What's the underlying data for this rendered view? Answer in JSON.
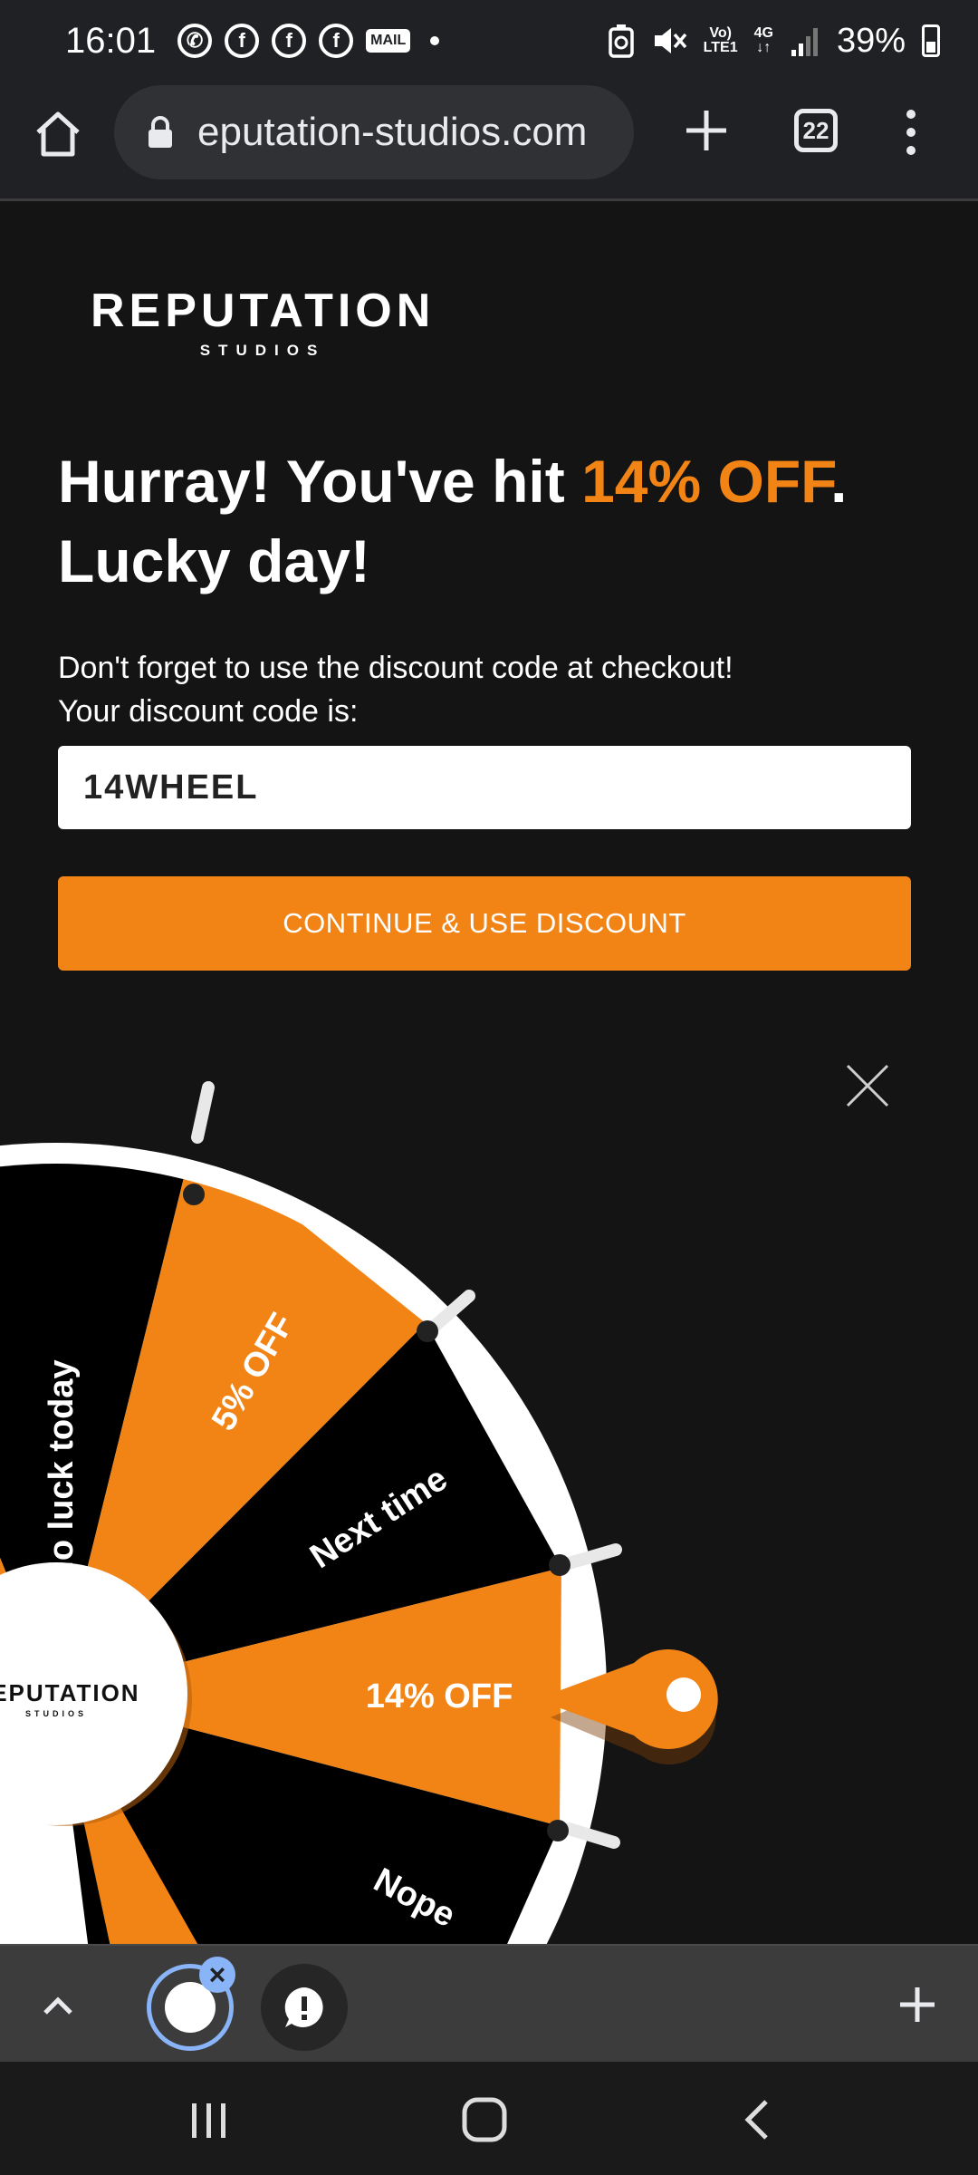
{
  "status_bar": {
    "time": "16:01",
    "app_icons": [
      "whatsapp-icon",
      "facebook-icon",
      "facebook-icon",
      "facebook-icon",
      "mail-icon"
    ],
    "mail_label": "MAIL",
    "volte_label": "Vo)",
    "lte_label": "LTE1",
    "network_label": "4G",
    "battery": "39%"
  },
  "browser": {
    "url": "eputation-studios.com",
    "tab_count": "22"
  },
  "brand": {
    "name": "REPUTATION",
    "sub": "STUDIOS"
  },
  "headline": {
    "prefix": "Hurray! You've hit ",
    "highlight": "14% OFF",
    "suffix": ".",
    "line2": "Lucky day!"
  },
  "info": {
    "line1": "Don't forget to use the discount code at checkout!",
    "line2": "Your discount code is:"
  },
  "discount_code": "14WHEEL",
  "cta_label": "CONTINUE & USE DISCOUNT",
  "wheel": {
    "hub_name": "REPUTATION",
    "hub_sub": "STUDIOS",
    "segments": [
      {
        "label": "No luck today",
        "color": "#000000"
      },
      {
        "label": "5% OFF",
        "color": "#f28416"
      },
      {
        "label": "Next time",
        "color": "#000000"
      },
      {
        "label": "14% OFF",
        "color": "#f28416"
      },
      {
        "label": "Nope",
        "color": "#000000"
      }
    ],
    "selected": "14% OFF"
  },
  "colors": {
    "accent": "#f28416",
    "background": "#141414",
    "chrome": "#202124"
  }
}
